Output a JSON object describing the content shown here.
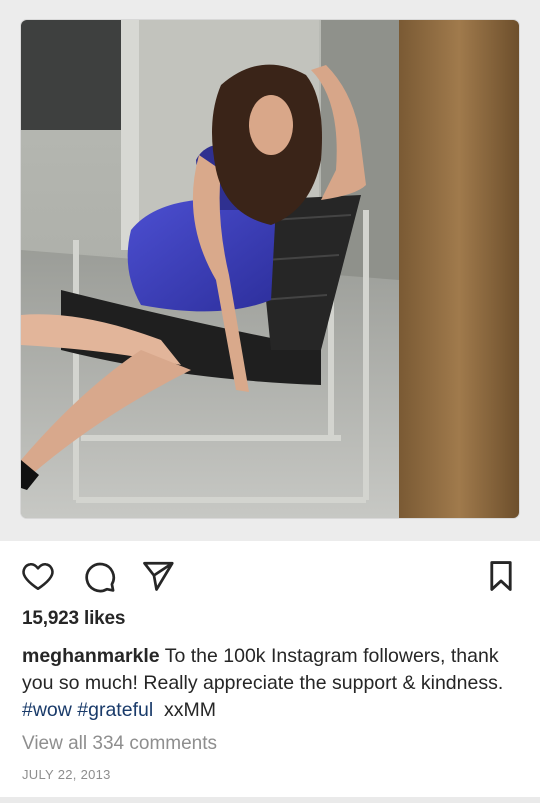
{
  "post": {
    "image_description_icon": "photo",
    "likes_text": "15,923 likes",
    "caption": {
      "username": "meghanmarkle",
      "text_1": "To the 100k Instagram followers, thank you so much! Really appreciate the support & kindness.",
      "hashtag_1": "#wow",
      "hashtag_2": "#grateful",
      "signoff": "xxMM"
    },
    "view_comments": "View all 334 comments",
    "date": "JULY 22, 2013"
  },
  "actions": {
    "like_icon": "heart-icon",
    "comment_icon": "comment-icon",
    "share_icon": "send-icon",
    "save_icon": "bookmark-icon"
  },
  "colors": {
    "text": "#262626",
    "muted": "#8e8e8e",
    "hashtag": "#1a3b6a"
  }
}
